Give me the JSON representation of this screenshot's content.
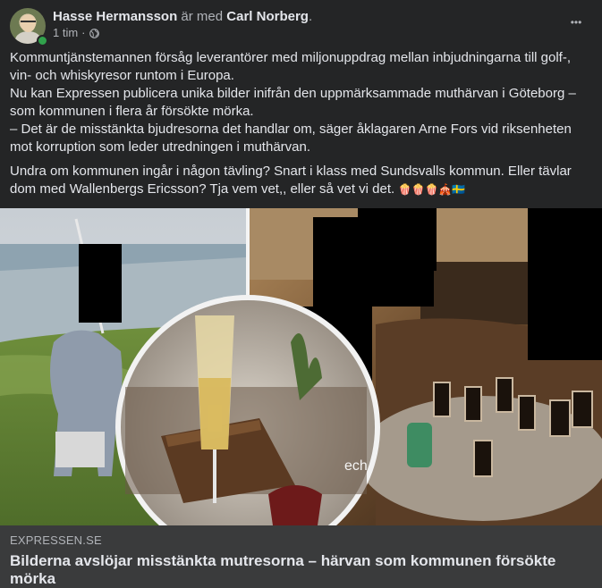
{
  "post": {
    "author": "Hasse Hermansson",
    "with_text": "är med",
    "tagged": "Carl Norberg",
    "tagged_suffix": ".",
    "time": "1 tim",
    "time_separator": "·",
    "privacy_icon": "globe-icon",
    "more_icon": "more-dots-icon",
    "more_label": "•••",
    "paragraph1": [
      "Kommuntjänstemannen försåg leverantörer med miljonuppdrag mellan inbjudningarna till golf-, vin- och whiskyresor runtom i Europa.",
      "Nu kan Expressen publicera unika bilder inifrån den uppmärksammade muthärvan i Göteborg – som kommunen i flera år försökte mörka.",
      "– Det är de misstänkta bjudresorna det handlar om, säger åklagaren Arne Fors vid riksenheten mot korruption som leder utredningen i muthärvan."
    ],
    "paragraph2": "Undra om kommunen ingår i någon tävling? Snart i klass med Sundsvalls kommun. Eller tävlar dom med Wallenbergs Ericsson? Tja vem vet,, eller så vet vi det.",
    "emojis": "🍿🍿🍿🎪🇸🇪"
  },
  "link_preview": {
    "domain": "EXPRESSEN.SE",
    "title": "Bilderna avslöjar misstänkta mutresorna – härvan som kommunen försökte mörka"
  },
  "colors": {
    "background": "#242526",
    "footer": "#3a3b3c",
    "text": "#e4e6eb",
    "muted": "#b0b3b8",
    "online": "#31a24c"
  }
}
